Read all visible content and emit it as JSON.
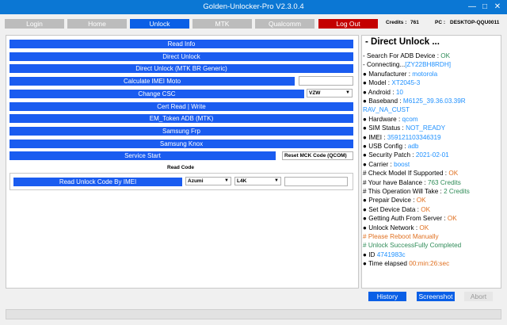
{
  "window": {
    "title": "Golden-Unlocker-Pro V2.3.0.4",
    "minimize": "—",
    "maximize": "□",
    "close": "✕"
  },
  "nav": {
    "login": "Login",
    "home": "Home",
    "unlock": "Unlock",
    "mtk": "MTK",
    "qualcomm": "Qualcomm",
    "logout": "Log Out"
  },
  "header": {
    "credits_label": "Credits :",
    "credits_value": "761",
    "pc_label": "PC :",
    "pc_value": "DESKTOP-QQU0011"
  },
  "actions": {
    "read_info": "Read Info",
    "direct_unlock": "Direct Unlock",
    "direct_unlock_mtk": "Direct Unlock (MTK BR Generic)",
    "calculate_imei": "Calculate IMEI Moto",
    "change_csc": "Change CSC",
    "cert_read_write": "Cert Read | Write",
    "em_token": "EM_Token ADB (MTK)",
    "samsung_frp": "Samsung Frp",
    "samsung_knox": "Samsung Knox",
    "service_start": "Service Start"
  },
  "selects": {
    "csc_value": "VZW",
    "service_value": "Reset MCK Code (QCOM)"
  },
  "read_code": {
    "section_label": "Read Code",
    "button": "Read Unlock Code By IMEI",
    "brand_value": "Azumi",
    "model_value": "L4K"
  },
  "log": {
    "title": "- Direct Unlock ...",
    "lines": [
      {
        "label": "- Search For ADB Device : ",
        "value": "OK",
        "color": "#2e8b57"
      },
      {
        "label": "- Connecting...",
        "value": "[ZY22BH8RDH]",
        "color": "#1e90ff"
      },
      {
        "label": "● Manufacturer : ",
        "value": "motorola",
        "color": "#1e90ff"
      },
      {
        "label": "● Model : ",
        "value": "XT2045-3",
        "color": "#1e90ff"
      },
      {
        "label": "● Android : ",
        "value": "10",
        "color": "#1e90ff"
      },
      {
        "label": "● Baseband : ",
        "value": "M6125_39.36.03.39R",
        "color": "#1e90ff"
      },
      {
        "label": "",
        "value": "RAV_NA_CUST",
        "color": "#1e90ff"
      },
      {
        "label": "● Hardware : ",
        "value": "qcom",
        "color": "#1e90ff"
      },
      {
        "label": "● SIM Status : ",
        "value": "NOT_READY",
        "color": "#1e90ff"
      },
      {
        "label": "● IMEI : ",
        "value": "359121103346319",
        "color": "#1e90ff"
      },
      {
        "label": "● USB Config : ",
        "value": "adb",
        "color": "#1e90ff"
      },
      {
        "label": "● Security Patch : ",
        "value": "2021-02-01",
        "color": "#1e90ff"
      },
      {
        "label": "● Carrier : ",
        "value": "boost",
        "color": "#1e90ff"
      },
      {
        "label": "# Check Model If Supported : ",
        "value": "OK",
        "color": "#e07020"
      },
      {
        "label": "# Your have Balance : ",
        "value": "763 Credits",
        "color": "#2e8b57"
      },
      {
        "label": "# This Operation Will Take : ",
        "value": "2 Credits",
        "color": "#2e8b57"
      },
      {
        "label": "● Prepair Device : ",
        "value": "OK",
        "color": "#e07020"
      },
      {
        "label": "● Set Device Data : ",
        "value": "OK",
        "color": "#e07020"
      },
      {
        "label": "● Getting Auth From Server : ",
        "value": "OK",
        "color": "#e07020"
      },
      {
        "label": "● Unlock Network : ",
        "value": "OK",
        "color": "#e07020"
      },
      {
        "label": "",
        "value": "# Please Reboot Manually",
        "color": "#e07020"
      },
      {
        "label": "",
        "value": "# Unlock SuccessFully Completed",
        "color": "#2e8b57"
      },
      {
        "label": "● ID ",
        "value": "4741983c",
        "color": "#1e90ff"
      },
      {
        "label": "● Time elapsed ",
        "value": "00:min:26:sec",
        "color": "#e07020"
      }
    ]
  },
  "footer": {
    "history": "History",
    "screenshot": "Screenshot",
    "abort": "Abort"
  },
  "colors": {
    "titlebar": "#0b77d4",
    "tab_inactive": "#bcbcbc",
    "tab_active": "#0a5fe6",
    "logout": "#c40000",
    "action_button": "#1a5cf0"
  }
}
